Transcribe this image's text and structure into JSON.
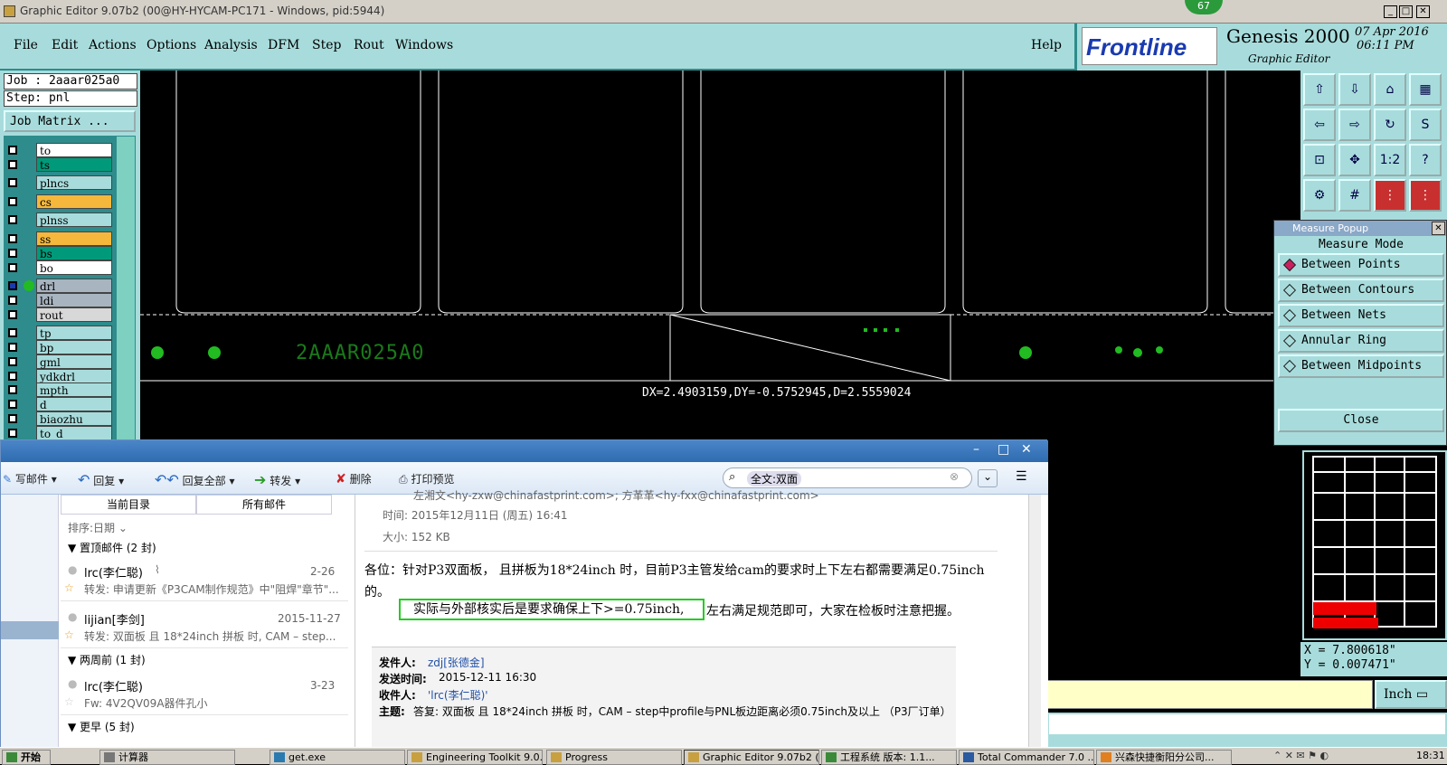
{
  "titlebar": {
    "title": "Graphic Editor 9.07b2 (00@HY-HYCAM-PC171 - Windows, pid:5944)",
    "badge": "67"
  },
  "menu": {
    "items": [
      "File",
      "Edit",
      "Actions",
      "Options",
      "Analysis",
      "DFM",
      "Step",
      "Rout",
      "Windows"
    ],
    "help": "Help"
  },
  "brand": {
    "logo": "Frontline",
    "product": "Genesis 2000",
    "subtitle": "Graphic Editor",
    "date": "07 Apr 2016",
    "time": "06:11 PM"
  },
  "left": {
    "job": "Job : 2aaar025a0",
    "step": "Step: pnl",
    "job_matrix": "Job Matrix ...",
    "layers": [
      {
        "name": "to",
        "color": "#ffffff"
      },
      {
        "name": "ts",
        "color": "#009a7a"
      },
      {
        "name": "plncs",
        "color": "#a8dcdc"
      },
      {
        "name": "cs",
        "color": "#f5b83c"
      },
      {
        "name": "plnss",
        "color": "#a8dcdc"
      },
      {
        "name": "ss",
        "color": "#f5b83c"
      },
      {
        "name": "bs",
        "color": "#009a7a"
      },
      {
        "name": "bo",
        "color": "#ffffff"
      },
      {
        "name": "drl",
        "color": "#a8b4c0"
      },
      {
        "name": "ldi",
        "color": "#a8b4c0"
      },
      {
        "name": "rout",
        "color": "#d8d8d8"
      },
      {
        "name": "tp",
        "color": "#a8dcdc"
      },
      {
        "name": "bp",
        "color": "#a8dcdc"
      },
      {
        "name": "gml",
        "color": "#a8dcdc"
      },
      {
        "name": "ydkdrl",
        "color": "#a8dcdc"
      },
      {
        "name": "mpth",
        "color": "#a8dcdc"
      },
      {
        "name": "d",
        "color": "#a8dcdc"
      },
      {
        "name": "biaozhu",
        "color": "#a8dcdc"
      },
      {
        "name": "to_d",
        "color": "#a8dcdc"
      }
    ]
  },
  "canvas": {
    "silk_text": "2AAAR025A0",
    "measure_readout": "DX=2.4903159,DY=-0.5752945,D=2.5559024"
  },
  "measure": {
    "title": "Measure Popup",
    "mode_label": "Measure Mode",
    "options": [
      "Between Points",
      "Between Contours",
      "Between Nets",
      "Annular Ring",
      "Between Midpoints"
    ],
    "close": "Close"
  },
  "coords": {
    "x": "X = 7.800618\"",
    "y": "Y = 0.007471\"",
    "unit": "Inch"
  },
  "email": {
    "toolbar": {
      "compose": "写邮件",
      "reply": "回复",
      "reply_all": "回复全部",
      "forward": "转发",
      "delete": "删除",
      "print": "打印预览"
    },
    "search": "全文:双面",
    "tabs": [
      "当前目录",
      "所有邮件"
    ],
    "sort": "排序:日期",
    "groups": {
      "pinned": "置顶邮件 (2 封)",
      "two_weeks": "两周前 (1 封)",
      "earlier": "更早 (5 封)"
    },
    "items": [
      {
        "from": "lrc(李仁聪)",
        "date": "2-26",
        "subject": "转发: 申请更新《P3CAM制作规范》中\"阻焊\"章节\"..."
      },
      {
        "from": "lijian[李剑]",
        "date": "2015-11-27",
        "subject": "转发: 双面板 且 18*24inch 拼板 时, CAM – step..."
      },
      {
        "from": "lrc(李仁聪)",
        "date": "3-23",
        "subject": "Fw: 4V2QV09A器件孔小"
      }
    ],
    "header_partial": "左湘文<hy-zxw@chinafastprint.com>; 方革革<hy-fxx@chinafastprint.com>",
    "time": "时间: 2015年12月11日 (周五) 16:41",
    "size": "大小: 152 KB",
    "body1": "各位：针对P3双面板， 且拼板为18*24inch 时，目前P3主管发给cam的要求时上下左右都需要满足0.75inch的。",
    "highlight": "实际与外部核实后是要求确保上下>=0.75inch,",
    "body2": " 左右满足规范即可，大家在检板时注意把握。",
    "quote": {
      "from_label": "发件人:",
      "from": "zdj[张德金]",
      "sent_label": "发送时间:",
      "sent": "2015-12-11 16:30",
      "to_label": "收件人:",
      "to": "'lrc(李仁聪)'",
      "subject_label": "主题:",
      "subject": "答复: 双面板 且 18*24inch 拼板 时，CAM – step中profile与PNL板边距离必须0.75inch及以上 （P3厂订单）"
    }
  },
  "taskbar": {
    "start": "开始",
    "tasks": [
      "计算器",
      "get.exe",
      "Engineering Toolkit 9.0...",
      "Progress",
      "Graphic Editor 9.07b2 (...",
      "工程系统  版本: 1.1...",
      "Total Commander 7.0 ...",
      "兴森快捷衡阳分公司..."
    ],
    "clock": "18:31"
  }
}
